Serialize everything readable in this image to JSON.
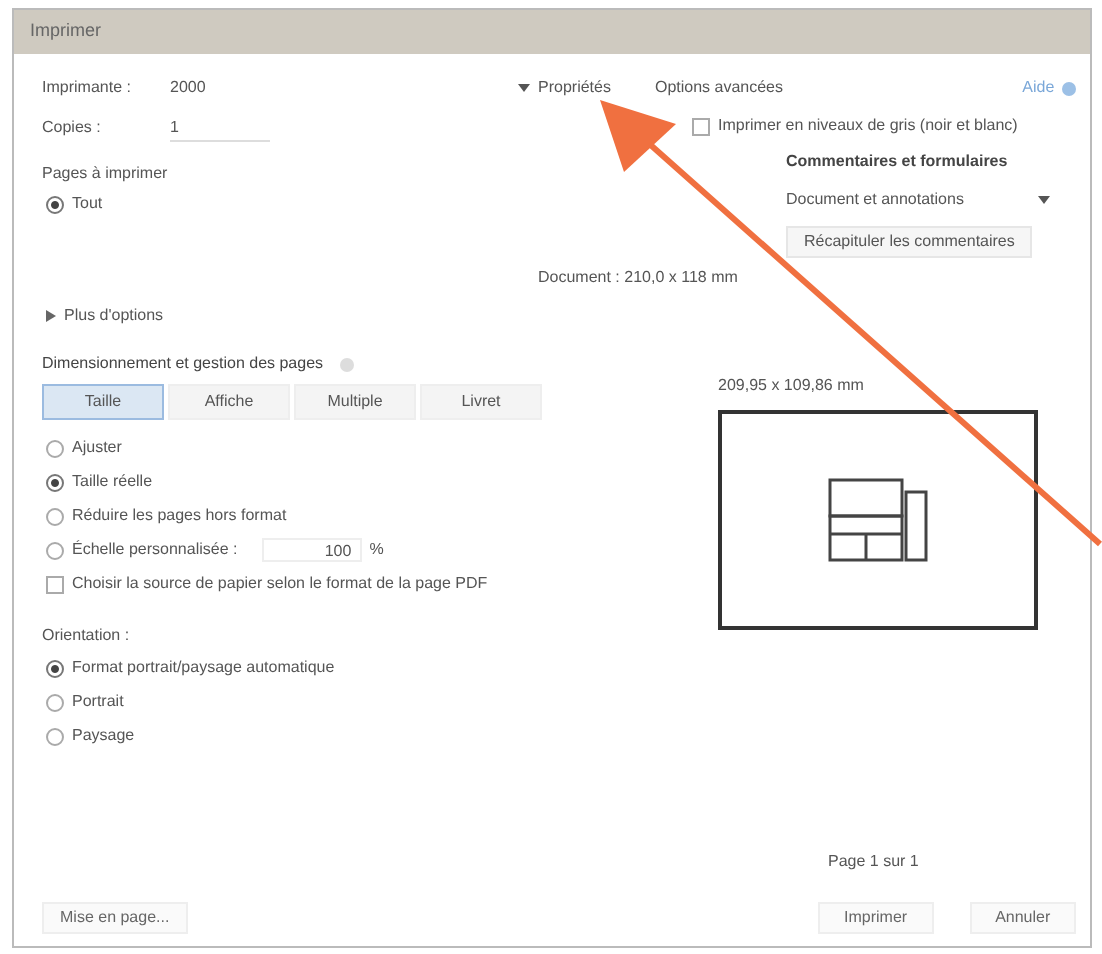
{
  "window": {
    "title": "Imprimer"
  },
  "printer": {
    "label": "Imprimante :",
    "value": "2000"
  },
  "top_links": [
    {
      "label": "Propriétés"
    },
    {
      "label": "Options avancées"
    }
  ],
  "help": {
    "label": "Aide"
  },
  "copies": {
    "label": "Copies :",
    "value": "1"
  },
  "grayscale": {
    "label": "Imprimer en niveaux de gris (noir et blanc)",
    "checked": false
  },
  "pages_section": {
    "title": "Pages à imprimer",
    "options": [
      {
        "label": "Tout",
        "selected": true
      }
    ],
    "more": "Plus d'options"
  },
  "sizing_section": {
    "title": "Dimensionnement et gestion des pages",
    "tabs": [
      {
        "label": "Taille",
        "selected": true
      },
      {
        "label": "Affiche",
        "selected": false
      },
      {
        "label": "Multiple",
        "selected": false
      },
      {
        "label": "Livret",
        "selected": false
      }
    ],
    "fit_options": [
      {
        "label": "Ajuster",
        "selected": false
      },
      {
        "label": "Taille réelle",
        "selected": true
      },
      {
        "label": "Réduire les pages hors format",
        "selected": false
      }
    ],
    "scale": {
      "label": "Échelle personnalisée :",
      "value": "100",
      "unit": "%",
      "selected": false
    },
    "paper_source": {
      "label": "Choisir la source de papier selon le format de la page PDF",
      "checked": false
    }
  },
  "orientation": {
    "title": "Orientation :",
    "options": [
      {
        "label": "Format portrait/paysage automatique",
        "selected": true
      },
      {
        "label": "Portrait",
        "selected": false
      },
      {
        "label": "Paysage",
        "selected": false
      }
    ]
  },
  "comments": {
    "title": "Commentaires et formulaires",
    "dropdown": "Document et annotations",
    "summary_button": "Récapituler les commentaires",
    "document_size": "Document : 210,0 x 118 mm"
  },
  "preview": {
    "size": "209,95 x 109,86 mm",
    "page_info": "Page 1 sur 1"
  },
  "buttons": [
    {
      "label": "Mise en page..."
    },
    {
      "label": "Imprimer"
    },
    {
      "label": "Annuler"
    }
  ]
}
